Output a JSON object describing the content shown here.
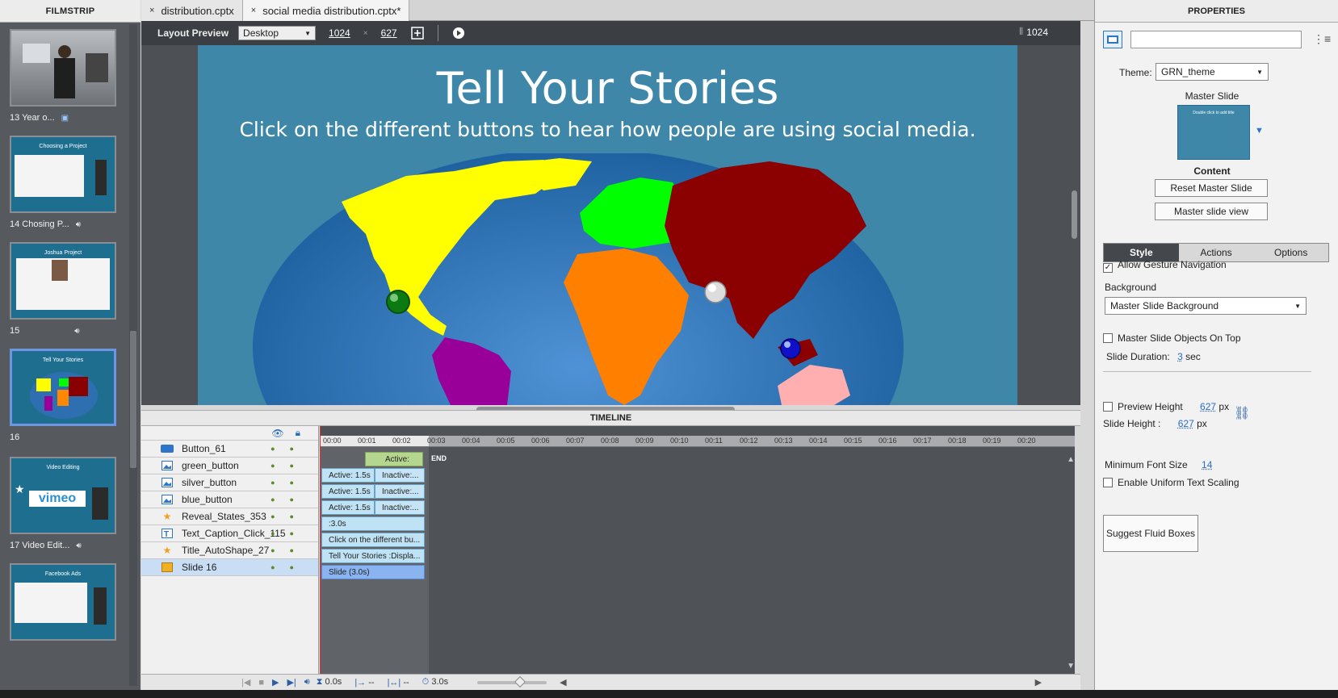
{
  "filmstrip": {
    "title": "FILMSTRIP",
    "items": [
      {
        "label": "13 Year o...",
        "icon": "interaction-icon",
        "thumb_text": ""
      },
      {
        "label": "14 Chosing P...",
        "icon": "audio-icon",
        "thumb_text": "Choosing a Project"
      },
      {
        "label": "15",
        "icon": "audio-icon",
        "thumb_text": "Joshua Project"
      },
      {
        "label": "16",
        "icon": "",
        "thumb_text": "Tell Your Stories"
      },
      {
        "label": "17 Video Edit...",
        "icon": "audio-icon",
        "thumb_text": "Video Editing"
      },
      {
        "label": "",
        "icon": "",
        "thumb_text": "Facebook Ads"
      }
    ]
  },
  "tabs": [
    {
      "label": "distribution.cptx",
      "close": "×"
    },
    {
      "label": "social media distribution.cptx*",
      "close": "×"
    }
  ],
  "layout_bar": {
    "label": "Layout Preview",
    "device": "Desktop",
    "width": "1024",
    "height": "627",
    "times": "×",
    "ruler_value": "1024"
  },
  "slide": {
    "title": "Tell Your Stories",
    "subtitle": "Click on the different buttons to hear how people are using social media.",
    "background": "#3e87a8"
  },
  "timeline": {
    "title": "TIMELINE",
    "ruler": [
      "00:00",
      "00:01",
      "00:02",
      "00:03",
      "00:04",
      "00:05",
      "00:06",
      "00:07",
      "00:08",
      "00:09",
      "00:10",
      "00:11",
      "00:12",
      "00:13",
      "00:14",
      "00:15",
      "00:16",
      "00:17",
      "00:18",
      "00:19",
      "00:20"
    ],
    "end_label": "END",
    "layers": [
      {
        "name": "Button_61",
        "icon": "button-icon",
        "bar1": "Active:",
        "bar2": ""
      },
      {
        "name": "green_button",
        "icon": "image-icon",
        "bar1": "Active: 1.5s",
        "bar2": "Inactive:..."
      },
      {
        "name": "silver_button",
        "icon": "image-icon",
        "bar1": "Active: 1.5s",
        "bar2": "Inactive:..."
      },
      {
        "name": "blue_button",
        "icon": "image-icon",
        "bar1": "Active: 1.5s",
        "bar2": "Inactive:..."
      },
      {
        "name": "Reveal_States_353",
        "icon": "star-icon",
        "bar1": ":3.0s",
        "bar2": ""
      },
      {
        "name": "Text_Caption_Click_115",
        "icon": "text-icon",
        "bar1": "Click on the different bu...",
        "bar2": ""
      },
      {
        "name": "Title_AutoShape_27",
        "icon": "star-icon",
        "bar1": "Tell Your Stories :Displa...",
        "bar2": ""
      },
      {
        "name": "Slide 16",
        "icon": "slide-icon",
        "bar1": "Slide (3.0s)",
        "bar2": ""
      }
    ],
    "bottom": {
      "current_time": "0.0s",
      "in": "--",
      "out": "--",
      "duration": "3.0s"
    }
  },
  "properties": {
    "title": "PROPERTIES",
    "name_value": "",
    "theme_label": "Theme:",
    "theme_value": "GRN_theme",
    "master_slide_label": "Master Slide",
    "master_thumb_text": "Double click to add title",
    "content_label": "Content",
    "reset_btn": "Reset Master Slide",
    "master_view_btn": "Master slide view",
    "tabs": [
      "Style",
      "Actions",
      "Options"
    ],
    "allow_gesture": "Allow Gesture Navigation",
    "background_label": "Background",
    "background_value": "Master Slide Background",
    "master_objects_top": "Master Slide Objects On Top",
    "slide_duration_label": "Slide Duration:",
    "slide_duration_value": "3",
    "slide_duration_unit": "sec",
    "preview_height_label": "Preview Height",
    "preview_height_value": "627",
    "slide_height_label": "Slide Height :",
    "slide_height_value": "627",
    "px": "px",
    "min_font_label": "Minimum Font Size",
    "min_font_value": "14",
    "uniform_text": "Enable Uniform Text Scaling",
    "suggest_btn": "Suggest Fluid Boxes"
  },
  "colors": {
    "accent": "#2b6cc4",
    "slide_bg": "#3e87a8"
  }
}
